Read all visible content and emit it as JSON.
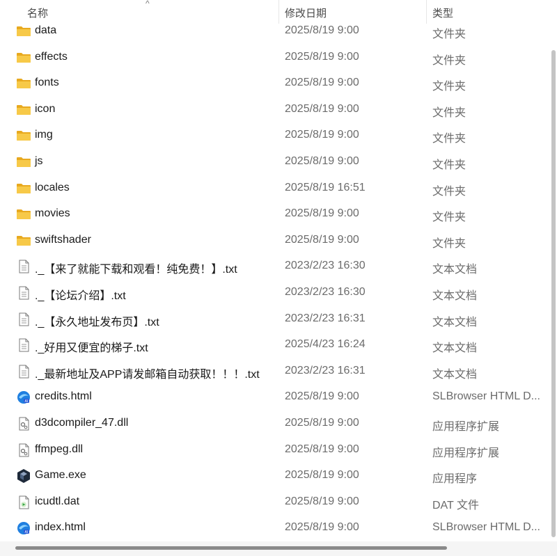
{
  "header": {
    "name_label": "名称",
    "date_label": "修改日期",
    "type_label": "类型",
    "sort_indicator": "^"
  },
  "files": [
    {
      "icon": "folder-icon",
      "name": "data",
      "date": "2025/8/19 9:00",
      "type": "文件夹"
    },
    {
      "icon": "folder-icon",
      "name": "effects",
      "date": "2025/8/19 9:00",
      "type": "文件夹"
    },
    {
      "icon": "folder-icon",
      "name": "fonts",
      "date": "2025/8/19 9:00",
      "type": "文件夹"
    },
    {
      "icon": "folder-icon",
      "name": "icon",
      "date": "2025/8/19 9:00",
      "type": "文件夹"
    },
    {
      "icon": "folder-icon",
      "name": "img",
      "date": "2025/8/19 9:00",
      "type": "文件夹"
    },
    {
      "icon": "folder-icon",
      "name": "js",
      "date": "2025/8/19 9:00",
      "type": "文件夹"
    },
    {
      "icon": "folder-icon",
      "name": "locales",
      "date": "2025/8/19 16:51",
      "type": "文件夹"
    },
    {
      "icon": "folder-icon",
      "name": "movies",
      "date": "2025/8/19 9:00",
      "type": "文件夹"
    },
    {
      "icon": "folder-icon",
      "name": "swiftshader",
      "date": "2025/8/19 9:00",
      "type": "文件夹"
    },
    {
      "icon": "text-file-icon",
      "name": "._【来了就能下载和观看！纯免费！】.txt",
      "date": "2023/2/23 16:30",
      "type": "文本文档"
    },
    {
      "icon": "text-file-icon",
      "name": "._【论坛介绍】.txt",
      "date": "2023/2/23 16:30",
      "type": "文本文档"
    },
    {
      "icon": "text-file-icon",
      "name": "._【永久地址发布页】.txt",
      "date": "2023/2/23 16:31",
      "type": "文本文档"
    },
    {
      "icon": "text-file-icon",
      "name": "._好用又便宜的梯子.txt",
      "date": "2025/4/23 16:24",
      "type": "文本文档"
    },
    {
      "icon": "text-file-icon",
      "name": "._最新地址及APP请发邮箱自动获取！！！.txt",
      "date": "2023/2/23 16:31",
      "type": "文本文档"
    },
    {
      "icon": "browser-html-icon",
      "name": "credits.html",
      "date": "2025/8/19 9:00",
      "type": "SLBrowser HTML D..."
    },
    {
      "icon": "dll-file-icon",
      "name": "d3dcompiler_47.dll",
      "date": "2025/8/19 9:00",
      "type": "应用程序扩展"
    },
    {
      "icon": "dll-file-icon",
      "name": "ffmpeg.dll",
      "date": "2025/8/19 9:00",
      "type": "应用程序扩展"
    },
    {
      "icon": "game-exe-icon",
      "name": "Game.exe",
      "date": "2025/8/19 9:00",
      "type": "应用程序"
    },
    {
      "icon": "dat-file-icon",
      "name": "icudtl.dat",
      "date": "2025/8/19 9:00",
      "type": "DAT 文件"
    },
    {
      "icon": "browser-html-icon",
      "name": "index.html",
      "date": "2025/8/19 9:00",
      "type": "SLBrowser HTML D..."
    }
  ],
  "colors": {
    "folder": "#f7c948",
    "folder_dark": "#e8a91f",
    "browser_blue": "#1f7fe0",
    "game_dark": "#1e2a3a"
  }
}
